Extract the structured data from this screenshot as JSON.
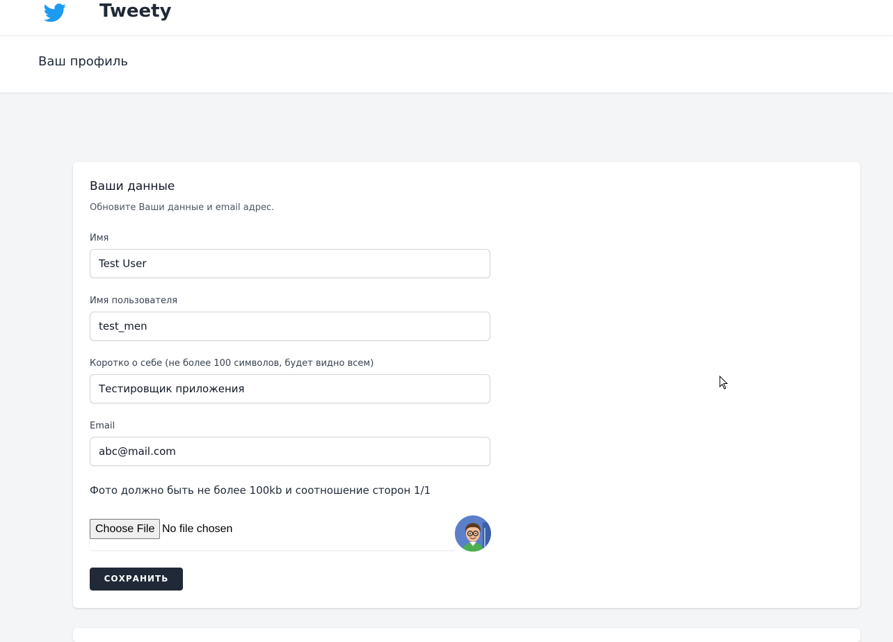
{
  "app": {
    "title": "Tweety",
    "logo_icon": "twitter-bird-icon",
    "accent": "#1d9bf0"
  },
  "header": {
    "title": "Ваш профиль"
  },
  "profile": {
    "section_title": "Ваши данные",
    "section_description": "Обновите Ваши данные и email адрес.",
    "fields": {
      "name": {
        "label": "Имя",
        "value": "Test User"
      },
      "username": {
        "label": "Имя пользователя",
        "value": "test_men"
      },
      "bio": {
        "label": "Коротко о себе (не более 100 символов, будет видно всем)",
        "value": "Тестировщик приложения"
      },
      "email": {
        "label": "Email",
        "value": "abc@mail.com"
      }
    },
    "photo_note": "Фото должно быть не более 100kb и соотношение сторон 1/1",
    "file_input": {
      "button_label": "Choose File",
      "status": "No file chosen"
    },
    "avatar_icon": "user-avatar-cartoon",
    "save_label": "СОХРАНИТЬ",
    "save_color": "#1f2937"
  }
}
